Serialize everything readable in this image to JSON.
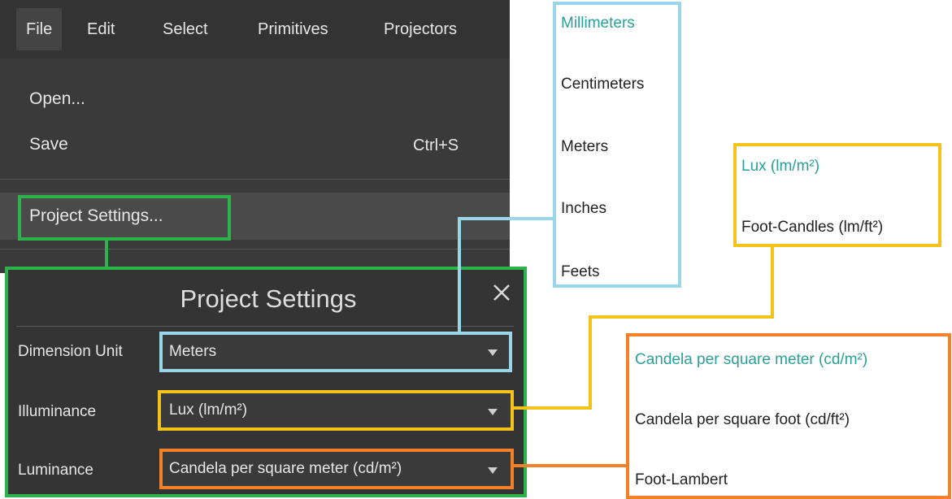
{
  "menubar": {
    "items": [
      {
        "label": "File",
        "active": true
      },
      {
        "label": "Edit"
      },
      {
        "label": "Select"
      },
      {
        "label": "Primitives"
      },
      {
        "label": "Projectors"
      }
    ]
  },
  "file_menu": {
    "open_label": "Open...",
    "save_label": "Save",
    "save_shortcut": "Ctrl+S",
    "project_settings_label": "Project Settings..."
  },
  "dialog": {
    "title": "Project Settings",
    "close_icon": "close-icon",
    "fields": {
      "dimension_unit": {
        "label": "Dimension Unit",
        "value": "Meters"
      },
      "illuminance": {
        "label": "Illuminance",
        "value": "Lux (lm/m²)"
      },
      "luminance": {
        "label": "Luminance",
        "value": "Candela per square meter (cd/m²)"
      }
    }
  },
  "dimension_options": {
    "items": [
      "Millimeters",
      "Centimeters",
      "Meters",
      "Inches",
      "Feets"
    ],
    "selected": "Millimeters"
  },
  "illuminance_options": {
    "items": [
      "Lux (lm/m²)",
      "Foot-Candles (lm/ft²)"
    ],
    "selected": "Lux (lm/m²)"
  },
  "luminance_options": {
    "items": [
      "Candela per square meter (cd/m²)",
      "Candela per square foot (cd/ft²)",
      "Foot-Lambert"
    ],
    "selected": "Candela per square meter (cd/m²)"
  },
  "colors": {
    "menu_bg": "#3a3a3a",
    "dialog_bg": "#343434",
    "selected_option": "#2aa198",
    "callout_project_settings": "#2eb24c",
    "callout_dimension": "#9ad6e8",
    "callout_illuminance": "#f4c21c",
    "callout_luminance": "#f5802a"
  }
}
